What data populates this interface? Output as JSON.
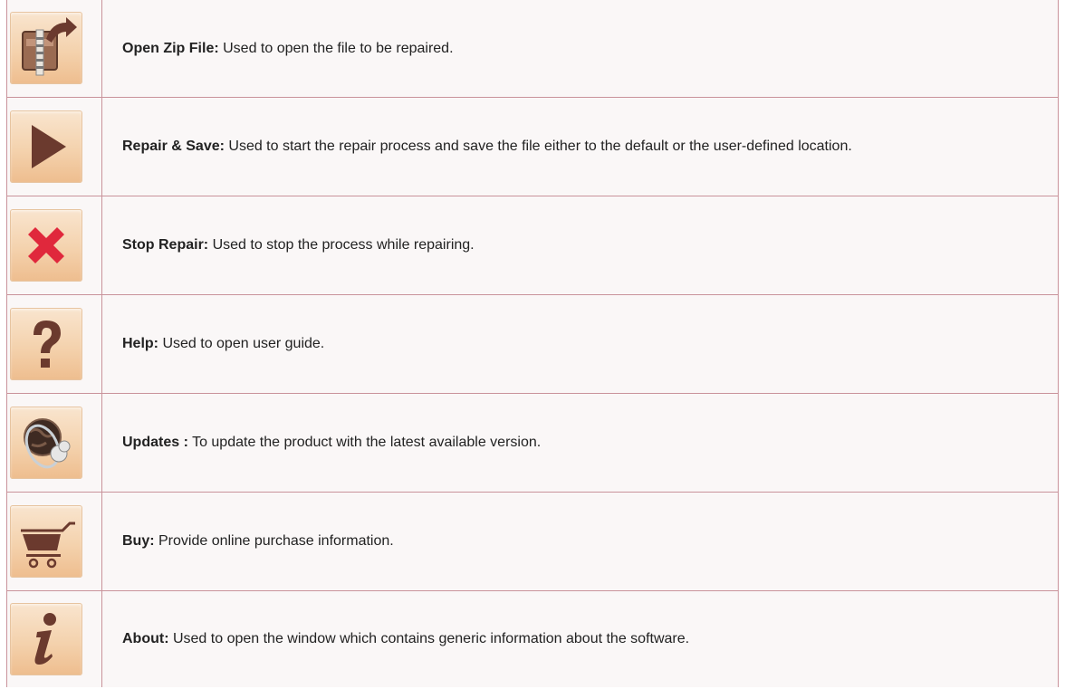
{
  "rows": [
    {
      "icon": "zip-archive-icon",
      "term": "Open Zip File:",
      "desc": " Used to open the file to be repaired."
    },
    {
      "icon": "play-icon",
      "term": "Repair & Save:",
      "desc": " Used to start the repair process and save the file either to the default or the user-defined location."
    },
    {
      "icon": "red-x-icon",
      "term": "Stop Repair:",
      "desc": " Used to stop the process while repairing."
    },
    {
      "icon": "question-mark-icon",
      "term": "Help:",
      "desc": " Used to open user guide."
    },
    {
      "icon": "globe-update-icon",
      "term": "Updates :",
      "desc": " To update the product with the latest available version."
    },
    {
      "icon": "shopping-cart-icon",
      "term": "Buy:",
      "desc": " Provide online purchase information."
    },
    {
      "icon": "info-icon",
      "term": "About:",
      "desc": " Used to open the window which contains generic information about the software."
    }
  ],
  "colors": {
    "border": "#c9939b",
    "icon_glyph": "#6b3a2e",
    "stop_red": "#e0283c"
  }
}
